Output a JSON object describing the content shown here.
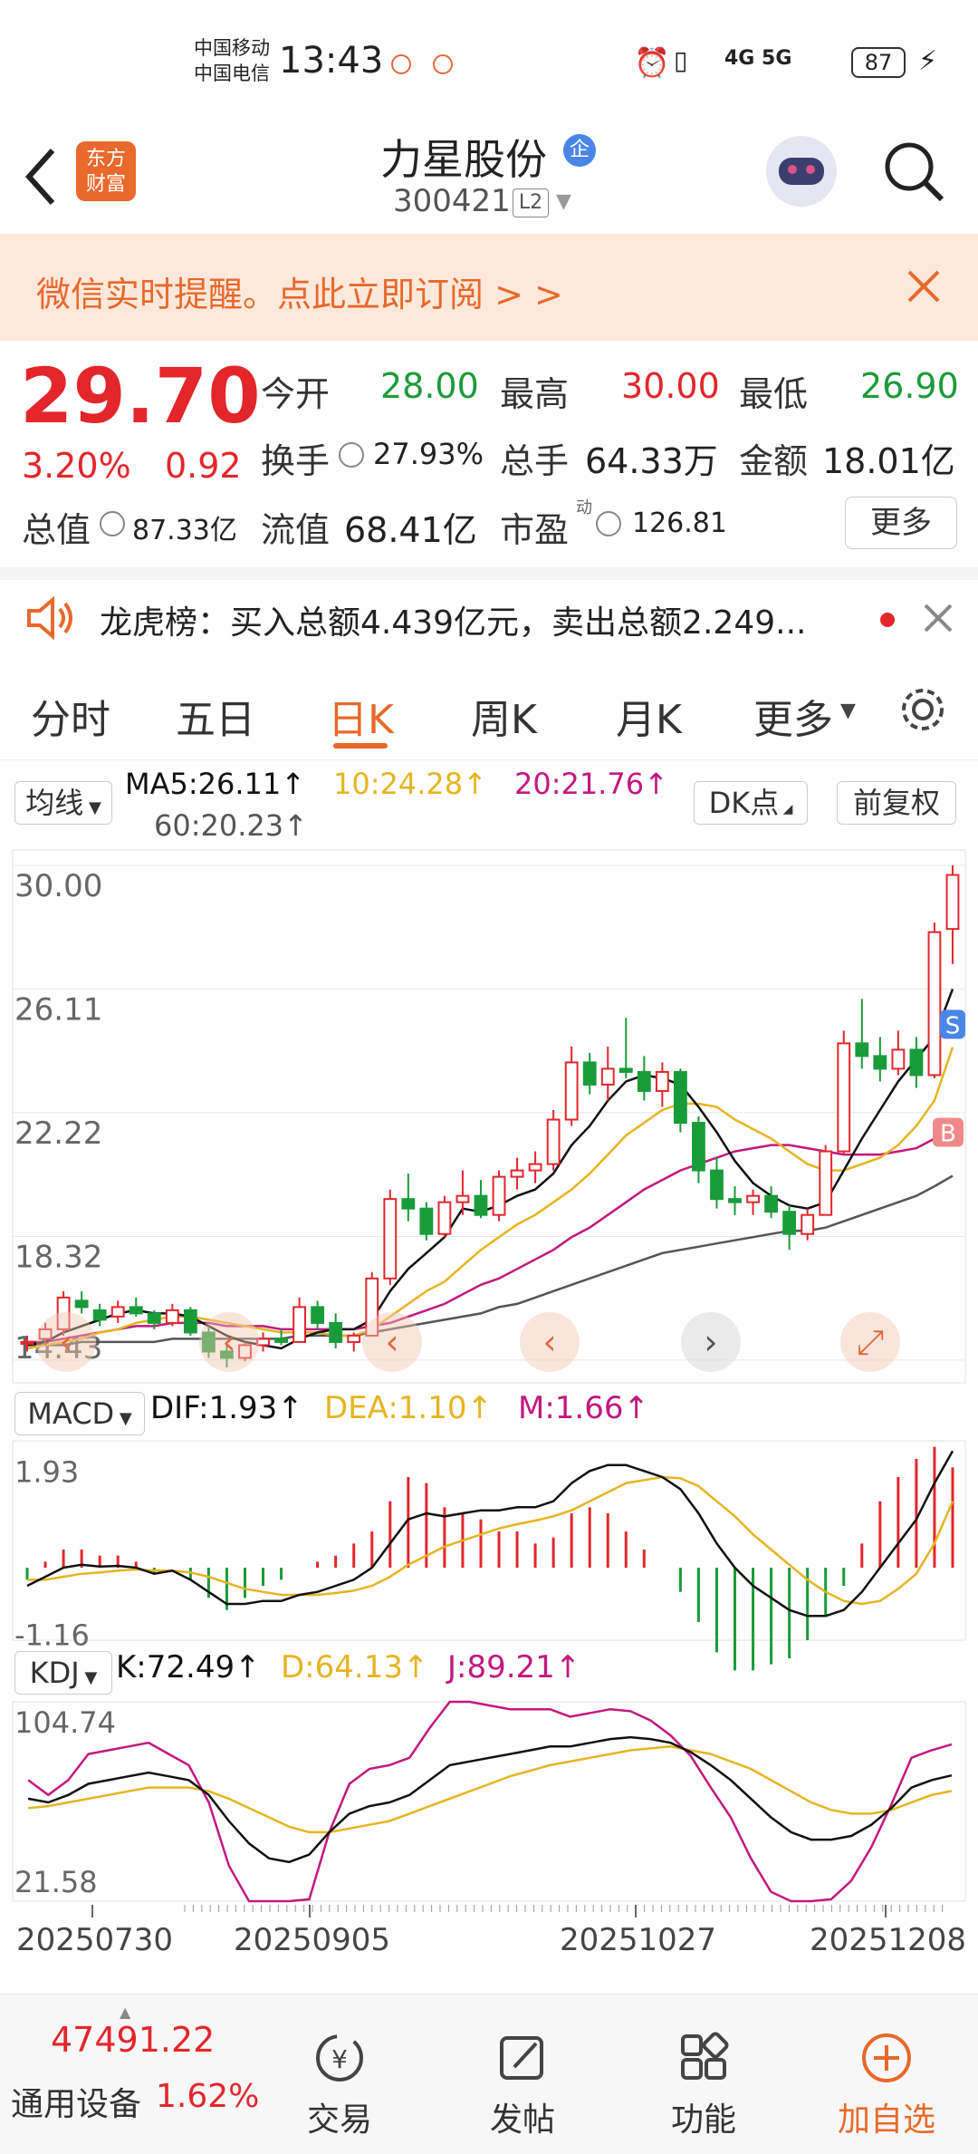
{
  "status": {
    "carrier1": "中国移动",
    "carrier2": "中国电信",
    "time": "13:43",
    "network": "4G 5G",
    "battery": "87"
  },
  "header": {
    "title": "力星股份",
    "code": "300421",
    "level": "L2",
    "logo_line1": "东方",
    "logo_line2": "财富",
    "badge": "企"
  },
  "banner": {
    "text": "微信实时提醒。点此立即订阅 > >"
  },
  "quote": {
    "price": "29.70",
    "change_pct": "3.20%",
    "change": "0.92",
    "open_label": "今开",
    "open": "28.00",
    "high_label": "最高",
    "high": "30.00",
    "low_label": "最低",
    "low": "26.90",
    "turnover_label": "换手",
    "turnover": "27.93%",
    "volume_label": "总手",
    "volume": "64.33万",
    "amount_label": "金额",
    "amount": "18.01亿",
    "mktcap_label": "总值",
    "mktcap": "87.33亿",
    "float_label": "流值",
    "float": "68.41亿",
    "pe_label": "市盈",
    "pe_sup": "动",
    "pe": "126.81",
    "more_label": "更多"
  },
  "notice": {
    "text": "龙虎榜：买入总额4.439亿元，卖出总额2.249..."
  },
  "tabs": [
    {
      "label": "分时"
    },
    {
      "label": "五日"
    },
    {
      "label": "日K"
    },
    {
      "label": "周K"
    },
    {
      "label": "月K"
    },
    {
      "label": "更多"
    }
  ],
  "active_tab": "日K",
  "indicators": {
    "ma_selector": "均线",
    "ma5": "MA5:26.11↑",
    "ma10": "10:24.28↑",
    "ma20": "20:21.76↑",
    "ma60": "60:20.23↑",
    "dk_label": "DK点",
    "adjust_label": "前复权",
    "macd_selector": "MACD",
    "dif": "DIF:1.93↑",
    "dea": "DEA:1.10↑",
    "m": "M:1.66↑",
    "kdj_selector": "KDJ",
    "k": "K:72.49↑",
    "d": "D:64.13↑",
    "j": "J:89.21↑",
    "s_marker": "S",
    "b_marker": "B"
  },
  "colors": {
    "up": "#e3262b",
    "down": "#1a9b3a",
    "ma5": "#111111",
    "ma10": "#e6b422",
    "ma20": "#c2187f",
    "ma60": "#555555",
    "accent": "#e8692b"
  },
  "chart_data": [
    {
      "type": "candlestick",
      "title": "",
      "y_ticks": [
        "30.00",
        "26.11",
        "22.22",
        "18.32",
        "14.43"
      ],
      "ylim": [
        14.43,
        30.0
      ],
      "x_ticks": [
        "20250730",
        "20250905",
        "20251027",
        "20251208"
      ],
      "ohlc": [
        [
          15.0,
          15.2,
          14.7,
          15.0
        ],
        [
          15.1,
          15.6,
          14.9,
          15.4
        ],
        [
          15.4,
          16.6,
          15.2,
          16.4
        ],
        [
          16.3,
          16.6,
          15.9,
          16.1
        ],
        [
          16.0,
          16.2,
          15.5,
          15.7
        ],
        [
          15.8,
          16.3,
          15.6,
          16.1
        ],
        [
          16.1,
          16.4,
          15.8,
          15.9
        ],
        [
          15.9,
          16.0,
          15.4,
          15.6
        ],
        [
          15.6,
          16.2,
          15.5,
          16.0
        ],
        [
          16.0,
          16.1,
          15.2,
          15.3
        ],
        [
          15.3,
          15.5,
          14.5,
          14.7
        ],
        [
          14.7,
          14.9,
          14.2,
          14.5
        ],
        [
          14.5,
          15.0,
          14.4,
          14.9
        ],
        [
          14.9,
          15.3,
          14.7,
          15.1
        ],
        [
          15.1,
          15.4,
          14.9,
          15.0
        ],
        [
          15.0,
          16.4,
          15.0,
          16.1
        ],
        [
          16.1,
          16.3,
          15.4,
          15.6
        ],
        [
          15.6,
          15.9,
          14.8,
          15.0
        ],
        [
          15.0,
          15.3,
          14.7,
          15.2
        ],
        [
          15.2,
          17.2,
          15.2,
          17.0
        ],
        [
          17.0,
          19.8,
          16.8,
          19.5
        ],
        [
          19.5,
          20.3,
          18.8,
          19.2
        ],
        [
          19.2,
          19.4,
          18.2,
          18.4
        ],
        [
          18.4,
          19.6,
          18.3,
          19.4
        ],
        [
          19.4,
          20.4,
          19.0,
          19.6
        ],
        [
          19.6,
          20.1,
          18.9,
          19.0
        ],
        [
          19.0,
          20.4,
          18.8,
          20.2
        ],
        [
          20.2,
          20.8,
          19.8,
          20.4
        ],
        [
          20.4,
          21.0,
          20.0,
          20.6
        ],
        [
          20.6,
          22.3,
          20.4,
          22.0
        ],
        [
          22.0,
          24.3,
          21.8,
          23.8
        ],
        [
          23.8,
          24.1,
          22.8,
          23.1
        ],
        [
          23.1,
          24.3,
          22.6,
          23.6
        ],
        [
          23.6,
          25.2,
          23.3,
          23.5
        ],
        [
          23.5,
          24.0,
          22.6,
          22.9
        ],
        [
          22.9,
          23.8,
          22.4,
          23.5
        ],
        [
          23.5,
          23.6,
          21.6,
          21.9
        ],
        [
          21.9,
          22.1,
          20.0,
          20.4
        ],
        [
          20.4,
          20.8,
          19.2,
          19.5
        ],
        [
          19.5,
          19.9,
          19.0,
          19.4
        ],
        [
          19.4,
          19.8,
          19.0,
          19.6
        ],
        [
          19.6,
          19.9,
          18.9,
          19.1
        ],
        [
          19.1,
          19.3,
          17.9,
          18.4
        ],
        [
          18.4,
          19.2,
          18.2,
          19.0
        ],
        [
          19.0,
          21.2,
          19.0,
          21.0
        ],
        [
          21.0,
          24.8,
          20.9,
          24.4
        ],
        [
          24.4,
          25.8,
          23.6,
          24.0
        ],
        [
          24.0,
          24.6,
          23.2,
          23.6
        ],
        [
          23.6,
          24.8,
          23.4,
          24.2
        ],
        [
          24.2,
          24.6,
          23.0,
          23.4
        ],
        [
          23.4,
          28.2,
          23.3,
          27.9
        ],
        [
          28.0,
          30.0,
          26.9,
          29.7
        ]
      ],
      "ma5": [
        14.9,
        15.0,
        15.3,
        15.5,
        15.7,
        15.9,
        16.0,
        15.9,
        15.9,
        15.8,
        15.5,
        15.2,
        15.0,
        14.9,
        14.8,
        15.1,
        15.3,
        15.4,
        15.4,
        15.7,
        16.6,
        17.3,
        17.8,
        18.3,
        19.2,
        19.1,
        19.3,
        19.6,
        19.8,
        20.3,
        21.2,
        21.8,
        22.6,
        23.2,
        23.4,
        23.3,
        23.1,
        22.4,
        21.6,
        20.7,
        20.0,
        19.6,
        19.3,
        19.2,
        19.4,
        20.4,
        21.4,
        22.3,
        23.2,
        23.9,
        24.6,
        26.11
      ],
      "ma10": [
        14.8,
        14.9,
        15.0,
        15.1,
        15.3,
        15.4,
        15.6,
        15.7,
        15.8,
        15.8,
        15.7,
        15.6,
        15.5,
        15.4,
        15.3,
        15.3,
        15.3,
        15.2,
        15.2,
        15.4,
        15.8,
        16.2,
        16.6,
        16.9,
        17.4,
        17.9,
        18.3,
        18.7,
        19.0,
        19.4,
        19.8,
        20.3,
        20.9,
        21.5,
        21.9,
        22.3,
        22.5,
        22.5,
        22.4,
        22.0,
        21.7,
        21.4,
        21.0,
        20.6,
        20.4,
        20.4,
        20.6,
        20.8,
        21.2,
        21.8,
        22.6,
        24.28
      ],
      "ma20": [
        15.0,
        15.0,
        15.1,
        15.2,
        15.3,
        15.4,
        15.5,
        15.5,
        15.6,
        15.6,
        15.6,
        15.5,
        15.5,
        15.5,
        15.4,
        15.4,
        15.4,
        15.4,
        15.4,
        15.5,
        15.6,
        15.8,
        16.0,
        16.2,
        16.5,
        16.8,
        17.0,
        17.3,
        17.6,
        17.9,
        18.3,
        18.6,
        19.0,
        19.4,
        19.8,
        20.1,
        20.4,
        20.6,
        20.8,
        21.0,
        21.1,
        21.2,
        21.2,
        21.1,
        21.0,
        20.9,
        20.9,
        20.9,
        21.0,
        21.1,
        21.4,
        21.76
      ],
      "ma60": [
        14.9,
        14.9,
        14.9,
        15.0,
        15.0,
        15.0,
        15.0,
        15.0,
        15.1,
        15.1,
        15.1,
        15.1,
        15.1,
        15.1,
        15.1,
        15.2,
        15.2,
        15.2,
        15.2,
        15.3,
        15.4,
        15.5,
        15.6,
        15.7,
        15.8,
        15.9,
        16.1,
        16.2,
        16.4,
        16.6,
        16.8,
        17.0,
        17.2,
        17.4,
        17.6,
        17.8,
        17.9,
        18.0,
        18.1,
        18.2,
        18.3,
        18.4,
        18.5,
        18.5,
        18.6,
        18.8,
        19.0,
        19.2,
        19.4,
        19.6,
        19.9,
        20.23
      ]
    },
    {
      "type": "line",
      "title": "MACD",
      "y_ticks": [
        "1.93",
        "-1.16"
      ],
      "ylim": [
        -1.16,
        1.93
      ],
      "dif": [
        -0.3,
        -0.15,
        0.0,
        0.05,
        0.02,
        0.03,
        0.0,
        -0.1,
        -0.05,
        -0.2,
        -0.4,
        -0.6,
        -0.6,
        -0.55,
        -0.55,
        -0.45,
        -0.4,
        -0.3,
        -0.2,
        0.0,
        0.4,
        0.8,
        0.9,
        0.85,
        0.9,
        0.95,
        0.95,
        1.0,
        1.0,
        1.1,
        1.4,
        1.6,
        1.7,
        1.7,
        1.6,
        1.5,
        1.3,
        0.9,
        0.4,
        0.0,
        -0.3,
        -0.5,
        -0.7,
        -0.8,
        -0.8,
        -0.7,
        -0.4,
        0.0,
        0.4,
        0.8,
        1.4,
        1.93
      ],
      "dea": [
        -0.2,
        -0.2,
        -0.15,
        -0.1,
        -0.08,
        -0.05,
        -0.03,
        -0.05,
        -0.05,
        -0.08,
        -0.15,
        -0.25,
        -0.35,
        -0.4,
        -0.45,
        -0.45,
        -0.45,
        -0.42,
        -0.38,
        -0.3,
        -0.15,
        0.05,
        0.2,
        0.35,
        0.45,
        0.55,
        0.65,
        0.72,
        0.78,
        0.85,
        0.95,
        1.1,
        1.25,
        1.4,
        1.45,
        1.5,
        1.48,
        1.35,
        1.1,
        0.85,
        0.55,
        0.3,
        0.05,
        -0.2,
        -0.4,
        -0.55,
        -0.6,
        -0.55,
        -0.35,
        -0.1,
        0.4,
        1.1
      ],
      "macd": [
        -0.2,
        0.1,
        0.3,
        0.3,
        0.2,
        0.2,
        0.1,
        -0.1,
        0.0,
        -0.2,
        -0.5,
        -0.7,
        -0.5,
        -0.3,
        -0.2,
        0.0,
        0.1,
        0.2,
        0.4,
        0.6,
        1.1,
        1.5,
        1.4,
        1.0,
        0.9,
        0.8,
        0.6,
        0.6,
        0.4,
        0.5,
        0.9,
        1.0,
        0.9,
        0.6,
        0.3,
        0.0,
        -0.4,
        -0.9,
        -1.4,
        -1.7,
        -1.7,
        -1.6,
        -1.5,
        -1.2,
        -0.8,
        -0.3,
        0.4,
        1.1,
        1.5,
        1.8,
        2.0,
        1.66
      ]
    },
    {
      "type": "line",
      "title": "KDJ",
      "y_ticks": [
        "104.74",
        "21.58"
      ],
      "ylim": [
        21.58,
        104.74
      ],
      "k": [
        60,
        58,
        62,
        68,
        70,
        72,
        74,
        72,
        70,
        62,
        48,
        36,
        28,
        26,
        30,
        42,
        52,
        56,
        58,
        62,
        70,
        78,
        80,
        82,
        84,
        86,
        88,
        88,
        90,
        92,
        93,
        92,
        90,
        85,
        78,
        70,
        60,
        50,
        42,
        38,
        38,
        40,
        46,
        55,
        66,
        70,
        72.49
      ],
      "d": [
        55,
        56,
        58,
        60,
        62,
        64,
        66,
        66,
        66,
        64,
        60,
        55,
        50,
        45,
        42,
        42,
        44,
        46,
        48,
        52,
        56,
        60,
        64,
        68,
        72,
        75,
        78,
        80,
        82,
        84,
        86,
        87,
        88,
        86,
        84,
        80,
        76,
        70,
        64,
        58,
        54,
        52,
        52,
        54,
        58,
        62,
        64.13
      ],
      "j": [
        70,
        62,
        70,
        84,
        86,
        88,
        90,
        84,
        78,
        58,
        24,
        0,
        -14,
        -12,
        6,
        42,
        68,
        76,
        78,
        82,
        98,
        114,
        112,
        110,
        108,
        108,
        108,
        104,
        106,
        108,
        107,
        102,
        94,
        83,
        66,
        50,
        28,
        10,
        -2,
        -2,
        6,
        16,
        34,
        57,
        82,
        86,
        89.21
      ]
    }
  ],
  "bottom_bar": {
    "index_value": "47491.22",
    "index_name": "通用设备",
    "index_change": "1.62%",
    "trade_label": "交易",
    "post_label": "发帖",
    "func_label": "功能",
    "add_label": "加自选"
  }
}
